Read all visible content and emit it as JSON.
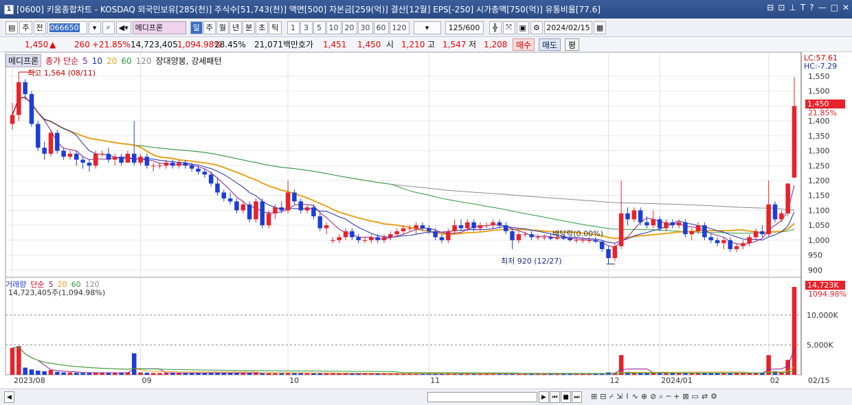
{
  "window": {
    "number": "1",
    "title": "[0600] 키움종합차트 - KOSDAQ 외국인보유[285(천)] 주식수[51,743(천)] 액면[500] 자본금[259(억)] 결산[12월] EPS[-250] 시가총액[750(억)] 유통비율[77.6]",
    "right_buttons": [
      "⊟",
      "⊡",
      "⊥",
      "T",
      "?",
      "—",
      "□",
      "✕"
    ]
  },
  "toolbar": {
    "type_jus": "주",
    "jeon": "전",
    "code": "066650",
    "stock_name": "메디프론",
    "periods": [
      "일",
      "주",
      "월",
      "년",
      "분",
      "초",
      "틱"
    ],
    "selected_period": "일",
    "intervals": [
      "1",
      "3",
      "5",
      "10",
      "20",
      "30",
      "60",
      "120"
    ],
    "count": "125/600",
    "date": "2024/02/15"
  },
  "price": {
    "current": "1,450",
    "change": "260",
    "change_pct": "+21.85%",
    "volume": "14,723,405",
    "volume_pct": "1,094.98%",
    "turnover": "28.45%",
    "amount": "21,071백만",
    "bid_label": "호가",
    "bid1": "1,451",
    "bid2": "1,450",
    "open_label": "시",
    "open": "1,210",
    "high_label": "고",
    "high": "1,547",
    "low_label": "저",
    "low": "1,208",
    "buy": "매수",
    "sell": "매도",
    "eval": "평"
  },
  "price_legend": {
    "name": "메디프론",
    "ma_label": "종가 단순",
    "ma5": "5",
    "ma10": "10",
    "ma20": "20",
    "ma60": "60",
    "ma120": "120",
    "pattern": "장대양봉, 강세패턴"
  },
  "annotations": {
    "high": "최고 1,564 (08/11)",
    "low": "최저 920 (12/27)",
    "dividend": "배당락(0.00%)",
    "lc": "LC:57.61",
    "hc": "HC:-7.29",
    "last_price": "1,450",
    "last_pct": "21.85%"
  },
  "volume_legend": {
    "label": "거래량",
    "ma_label": "단순",
    "ma5": "5",
    "ma20": "20",
    "ma60": "60",
    "ma120": "120",
    "value": "14,723,405주(1,094.98%)",
    "last_volume": "14,723K",
    "last_pct": "1094.98%"
  },
  "x_labels": [
    "2023/08",
    "09",
    "10",
    "11",
    "12",
    "2024/01",
    "02",
    "02/15"
  ],
  "colors": {
    "up": "#e8222a",
    "down": "#1b3fd6",
    "ma5": "#8b1a8b",
    "ma10": "#1a2aa8",
    "ma20": "#e6a21b",
    "ma60": "#2a9a3a",
    "ma120": "#8a8a8a"
  },
  "chart_data": {
    "type": "candlestick",
    "y_ticks": [
      "1,550",
      "1,500",
      "1,450",
      "1,400",
      "1,350",
      "1,300",
      "1,250",
      "1,200",
      "1,150",
      "1,100",
      "1,050",
      "1,000",
      "950",
      "900"
    ],
    "ylim": [
      880,
      1580
    ],
    "vol_ticks": [
      "10,000K",
      "5,000K"
    ],
    "vol_ylim": [
      0,
      14723
    ],
    "candles": [
      [
        1390,
        1460,
        1370,
        1420
      ],
      [
        1420,
        1564,
        1400,
        1530
      ],
      [
        1530,
        1540,
        1470,
        1490
      ],
      [
        1490,
        1500,
        1380,
        1390
      ],
      [
        1390,
        1400,
        1300,
        1310
      ],
      [
        1310,
        1330,
        1270,
        1290
      ],
      [
        1290,
        1370,
        1280,
        1360
      ],
      [
        1360,
        1370,
        1290,
        1300
      ],
      [
        1300,
        1310,
        1270,
        1280
      ],
      [
        1280,
        1300,
        1270,
        1290
      ],
      [
        1290,
        1300,
        1250,
        1270
      ],
      [
        1270,
        1280,
        1240,
        1260
      ],
      [
        1260,
        1270,
        1230,
        1250
      ],
      [
        1250,
        1300,
        1240,
        1290
      ],
      [
        1290,
        1300,
        1280,
        1290
      ],
      [
        1290,
        1310,
        1260,
        1270
      ],
      [
        1270,
        1290,
        1250,
        1280
      ],
      [
        1280,
        1290,
        1250,
        1260
      ],
      [
        1260,
        1300,
        1260,
        1290
      ],
      [
        1290,
        1400,
        1250,
        1260
      ],
      [
        1260,
        1290,
        1250,
        1280
      ],
      [
        1280,
        1290,
        1240,
        1250
      ],
      [
        1250,
        1260,
        1230,
        1250
      ],
      [
        1250,
        1260,
        1240,
        1250
      ],
      [
        1250,
        1270,
        1240,
        1260
      ],
      [
        1260,
        1270,
        1240,
        1250
      ],
      [
        1250,
        1270,
        1240,
        1260
      ],
      [
        1260,
        1270,
        1240,
        1250
      ],
      [
        1250,
        1260,
        1230,
        1240
      ],
      [
        1240,
        1250,
        1220,
        1230
      ],
      [
        1230,
        1240,
        1210,
        1220
      ],
      [
        1220,
        1230,
        1180,
        1190
      ],
      [
        1190,
        1210,
        1150,
        1160
      ],
      [
        1160,
        1170,
        1130,
        1140
      ],
      [
        1140,
        1160,
        1120,
        1130
      ],
      [
        1130,
        1140,
        1090,
        1100
      ],
      [
        1100,
        1130,
        1090,
        1120
      ],
      [
        1120,
        1130,
        1060,
        1070
      ],
      [
        1070,
        1140,
        1060,
        1130
      ],
      [
        1130,
        1140,
        1040,
        1050
      ],
      [
        1050,
        1100,
        1040,
        1090
      ],
      [
        1090,
        1120,
        1070,
        1110
      ],
      [
        1110,
        1130,
        1090,
        1100
      ],
      [
        1100,
        1200,
        1090,
        1160
      ],
      [
        1160,
        1170,
        1120,
        1130
      ],
      [
        1130,
        1140,
        1090,
        1100
      ],
      [
        1100,
        1120,
        1090,
        1110
      ],
      [
        1110,
        1120,
        1070,
        1080
      ],
      [
        1080,
        1090,
        1030,
        1040
      ],
      [
        1040,
        1060,
        1020,
        1050
      ],
      [
        1000,
        1010,
        990,
        1000
      ],
      [
        1000,
        1020,
        990,
        1010
      ],
      [
        1010,
        1040,
        1000,
        1030
      ],
      [
        1030,
        1040,
        1000,
        1010
      ],
      [
        1010,
        1020,
        990,
        1000
      ],
      [
        1000,
        1010,
        990,
        1000
      ],
      [
        1000,
        1020,
        990,
        1010
      ],
      [
        1010,
        1020,
        990,
        1000
      ],
      [
        1000,
        1020,
        990,
        1010
      ],
      [
        1010,
        1030,
        1000,
        1020
      ],
      [
        1020,
        1040,
        1010,
        1030
      ],
      [
        1030,
        1050,
        1020,
        1040
      ],
      [
        1040,
        1050,
        1030,
        1040
      ],
      [
        1040,
        1060,
        1020,
        1050
      ],
      [
        1050,
        1060,
        1030,
        1040
      ],
      [
        1040,
        1050,
        1020,
        1030
      ],
      [
        1030,
        1040,
        1000,
        1010
      ],
      [
        1010,
        1020,
        990,
        1000
      ],
      [
        1000,
        1040,
        990,
        1030
      ],
      [
        1030,
        1070,
        1020,
        1050
      ],
      [
        1050,
        1070,
        1030,
        1040
      ],
      [
        1040,
        1070,
        1030,
        1060
      ],
      [
        1060,
        1070,
        1030,
        1040
      ],
      [
        1040,
        1060,
        1030,
        1050
      ],
      [
        1050,
        1060,
        1040,
        1050
      ],
      [
        1050,
        1070,
        1040,
        1060
      ],
      [
        1060,
        1070,
        1040,
        1050
      ],
      [
        1050,
        1060,
        1020,
        1030
      ],
      [
        1030,
        1040,
        970,
        1000
      ],
      [
        1000,
        1030,
        990,
        1020
      ],
      [
        1020,
        1030,
        1010,
        1020
      ],
      [
        1020,
        1030,
        1000,
        1010
      ],
      [
        1010,
        1020,
        1000,
        1010
      ],
      [
        1010,
        1020,
        1000,
        1010
      ],
      [
        1010,
        1020,
        1000,
        1005
      ],
      [
        1005,
        1020,
        1000,
        1010
      ],
      [
        1010,
        1020,
        1000,
        1005
      ],
      [
        1005,
        1015,
        995,
        1000
      ],
      [
        1000,
        1010,
        990,
        1000
      ],
      [
        1000,
        1010,
        990,
        1000
      ],
      [
        1000,
        1010,
        990,
        1000
      ],
      [
        1000,
        1010,
        990,
        995
      ],
      [
        995,
        1000,
        960,
        970
      ],
      [
        970,
        980,
        920,
        940
      ],
      [
        940,
        990,
        930,
        980
      ],
      [
        980,
        1200,
        970,
        1090
      ],
      [
        1090,
        1110,
        1050,
        1070
      ],
      [
        1070,
        1110,
        1060,
        1100
      ],
      [
        1100,
        1110,
        1050,
        1060
      ],
      [
        1060,
        1080,
        1040,
        1050
      ],
      [
        1050,
        1100,
        1040,
        1070
      ],
      [
        1070,
        1080,
        1030,
        1040
      ],
      [
        1040,
        1070,
        1030,
        1060
      ],
      [
        1060,
        1070,
        1040,
        1050
      ],
      [
        1050,
        1070,
        1040,
        1060
      ],
      [
        1060,
        1070,
        1010,
        1020
      ],
      [
        1020,
        1040,
        1000,
        1030
      ],
      [
        1030,
        1060,
        1020,
        1050
      ],
      [
        1050,
        1060,
        1000,
        1010
      ],
      [
        1010,
        1020,
        990,
        1000
      ],
      [
        1000,
        1010,
        980,
        990
      ],
      [
        990,
        1010,
        970,
        1000
      ],
      [
        1000,
        1010,
        960,
        970
      ],
      [
        970,
        990,
        960,
        980
      ],
      [
        980,
        1000,
        970,
        990
      ],
      [
        990,
        1020,
        980,
        1010
      ],
      [
        1010,
        1040,
        1000,
        1030
      ],
      [
        1030,
        1050,
        1010,
        1020
      ],
      [
        1020,
        1200,
        1010,
        1120
      ],
      [
        1120,
        1130,
        1060,
        1070
      ],
      [
        1070,
        1100,
        1060,
        1090
      ],
      [
        1090,
        1190,
        1080,
        1190
      ],
      [
        1210,
        1547,
        1208,
        1450
      ]
    ],
    "volumes": [
      4500,
      4800,
      1200,
      900,
      700,
      600,
      800,
      500,
      400,
      400,
      350,
      300,
      300,
      400,
      300,
      350,
      300,
      300,
      400,
      3600,
      400,
      350,
      300,
      300,
      300,
      300,
      300,
      300,
      300,
      300,
      300,
      350,
      350,
      300,
      300,
      300,
      300,
      300,
      350,
      300,
      300,
      300,
      300,
      350,
      300,
      300,
      250,
      250,
      300,
      250,
      200,
      200,
      200,
      200,
      200,
      200,
      200,
      200,
      200,
      200,
      200,
      200,
      200,
      200,
      200,
      200,
      200,
      200,
      250,
      200,
      200,
      200,
      200,
      200,
      200,
      200,
      200,
      200,
      200,
      200,
      200,
      200,
      200,
      200,
      200,
      200,
      200,
      200,
      200,
      200,
      200,
      200,
      250,
      400,
      300,
      3300,
      500,
      400,
      400,
      300,
      300,
      300,
      300,
      300,
      300,
      300,
      300,
      300,
      300,
      300,
      300,
      300,
      300,
      300,
      300,
      300,
      300,
      300,
      3300,
      600,
      500,
      2500,
      14723
    ],
    "dividend_index": 93
  }
}
